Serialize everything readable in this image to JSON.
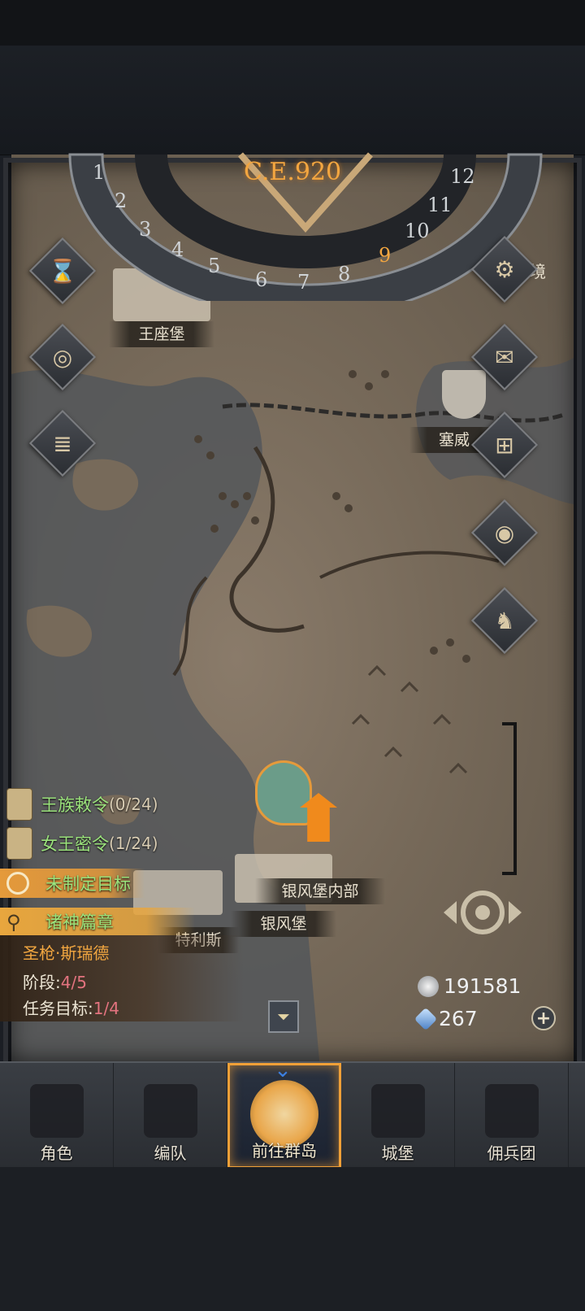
{
  "header": {
    "year": "C.E.920"
  },
  "calendar": {
    "months": [
      "1",
      "2",
      "3",
      "4",
      "5",
      "6",
      "7",
      "8",
      "9",
      "10",
      "11",
      "12"
    ],
    "current_month": "9"
  },
  "right_menu": {
    "top_label": "境",
    "items": [
      "gear-icon",
      "mail-icon",
      "map-grid-icon",
      "shield-icon",
      "knight-helmet-icon"
    ]
  },
  "left_menu": {
    "items": [
      "hourglass-icon",
      "bag-icon",
      "scroll-icon"
    ]
  },
  "locations": {
    "throne_castle": "王座堡",
    "saiwei": "塞威",
    "silverwind_inner": "银风堡内部",
    "silverwind": "银风堡",
    "tris": "特利斯"
  },
  "quests": [
    {
      "name": "王族敕令",
      "count": "(0/24)"
    },
    {
      "name": "女王密令",
      "count": "(1/24)"
    }
  ],
  "goal": {
    "label": "未制定目标"
  },
  "chapter": {
    "title": "诸神篇章",
    "hero": "圣枪·斯瑞德",
    "stage_label": "阶段:",
    "stage_value": "4/5",
    "task_label": "任务目标:",
    "task_value": "1/4"
  },
  "currency": {
    "silver": "191581",
    "crystal": "267"
  },
  "nav": {
    "tabs": [
      {
        "label": "角色",
        "active": false
      },
      {
        "label": "编队",
        "active": false
      },
      {
        "label": "前往群岛",
        "active": true
      },
      {
        "label": "城堡",
        "active": false
      },
      {
        "label": "佣兵团",
        "active": false
      }
    ]
  },
  "colors": {
    "accent_orange": "#f0a038",
    "quest_green": "#9be37c",
    "map_parchment": "#7e7060",
    "frame": "#2d2f34"
  }
}
